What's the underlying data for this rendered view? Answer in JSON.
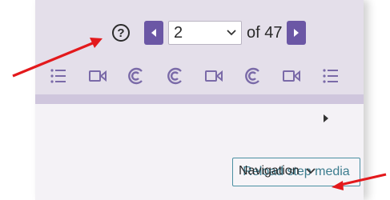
{
  "pager": {
    "current_page": "2",
    "total_label": "of 47",
    "help_icon": "question-icon",
    "prev_icon": "caret-left-icon",
    "next_icon": "caret-right-icon"
  },
  "toolbar_icons": [
    "list-icon",
    "video-icon",
    "audio-icon",
    "audio-icon",
    "video-icon",
    "audio-icon",
    "video-icon",
    "list-icon"
  ],
  "actions": {
    "reload_label": "Reload step media",
    "navigation_label": "Navigation"
  },
  "colors": {
    "accent": "#6b57a5",
    "reload_border": "#4b8fa2",
    "annotation_arrow": "#e3191c"
  }
}
